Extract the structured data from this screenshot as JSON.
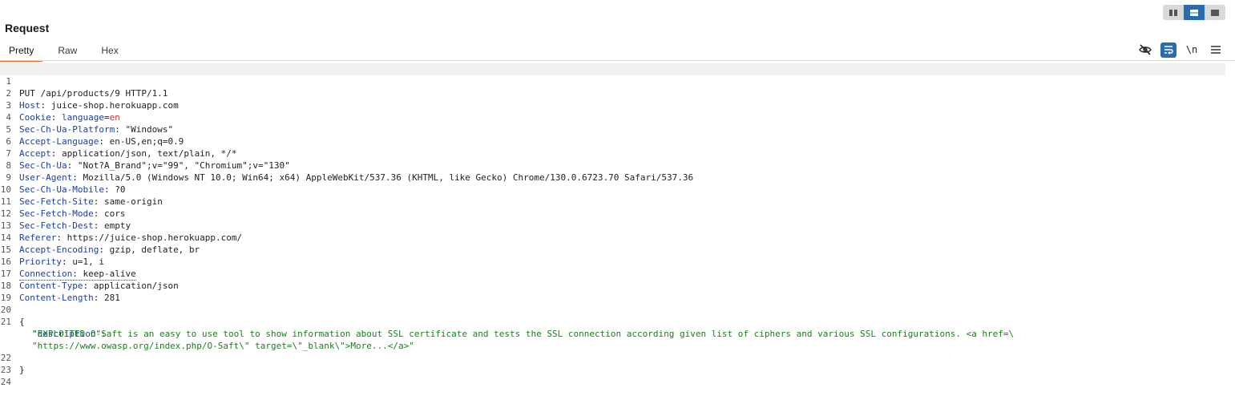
{
  "panel": {
    "title": "Request"
  },
  "layout_toggle": {
    "options": [
      "split-vertical",
      "split-horizontal",
      "single"
    ],
    "active": "split-horizontal",
    "accent": "#2b6cb0"
  },
  "tabs": [
    {
      "label": "Pretty",
      "active": true
    },
    {
      "label": "Raw",
      "active": false
    },
    {
      "label": "Hex",
      "active": false
    }
  ],
  "toolbar": {
    "hide_icon": "eye-off-icon",
    "wrap_icon": "wrap-lines-icon",
    "newline_label": "\\n",
    "menu_icon": "hamburger-menu-icon"
  },
  "request": {
    "request_line": "PUT /api/products/9 HTTP/1.1",
    "headers": [
      {
        "name": "Host",
        "value": "juice-shop.herokuapp.com"
      },
      {
        "name": "Cookie",
        "value": ""
      },
      {
        "name": "Sec-Ch-Ua-Platform",
        "value": "\"Windows\""
      },
      {
        "name": "Accept-Language",
        "value": "en-US,en;q=0.9"
      },
      {
        "name": "Accept",
        "value": "application/json, text/plain, */*"
      },
      {
        "name": "Sec-Ch-Ua",
        "value": "\"Not?A_Brand\";v=\"99\", \"Chromium\";v=\"130\""
      },
      {
        "name": "User-Agent",
        "value": "Mozilla/5.0 (Windows NT 10.0; Win64; x64) AppleWebKit/537.36 (KHTML, like Gecko) Chrome/130.0.6723.70 Safari/537.36"
      },
      {
        "name": "Sec-Ch-Ua-Mobile",
        "value": "?0"
      },
      {
        "name": "Sec-Fetch-Site",
        "value": "same-origin"
      },
      {
        "name": "Sec-Fetch-Mode",
        "value": "cors"
      },
      {
        "name": "Sec-Fetch-Dest",
        "value": "empty"
      },
      {
        "name": "Referer",
        "value": "https://juice-shop.herokuapp.com/"
      },
      {
        "name": "Accept-Encoding",
        "value": "gzip, deflate, br"
      },
      {
        "name": "Priority",
        "value": "u=1, i"
      },
      {
        "name": "Connection",
        "value": "keep-alive"
      },
      {
        "name": "Content-Type",
        "value": "application/json"
      },
      {
        "name": "Content-Length",
        "value": "281"
      }
    ],
    "cookie": {
      "key": "language",
      "eq": "=",
      "val": "en"
    },
    "body": {
      "open_brace": "{",
      "key": "\"description\"",
      "colon": ":",
      "value_line1": "\"EXPLOITED O-Saft is an easy to use tool to show information about SSL certificate and tests the SSL connection according given list of ciphers and various SSL configurations. <a href=\\",
      "value_line2": "\"https://www.owasp.org/index.php/O-Saft\\\" target=\\\"_blank\\\">More...</a>\"",
      "close_brace": "}"
    },
    "line_numbers": [
      "1",
      "2",
      "3",
      "4",
      "5",
      "6",
      "7",
      "8",
      "9",
      "10",
      "11",
      "12",
      "13",
      "14",
      "15",
      "16",
      "17",
      "18",
      "19",
      "20",
      "21",
      "22",
      "23",
      "24"
    ]
  }
}
